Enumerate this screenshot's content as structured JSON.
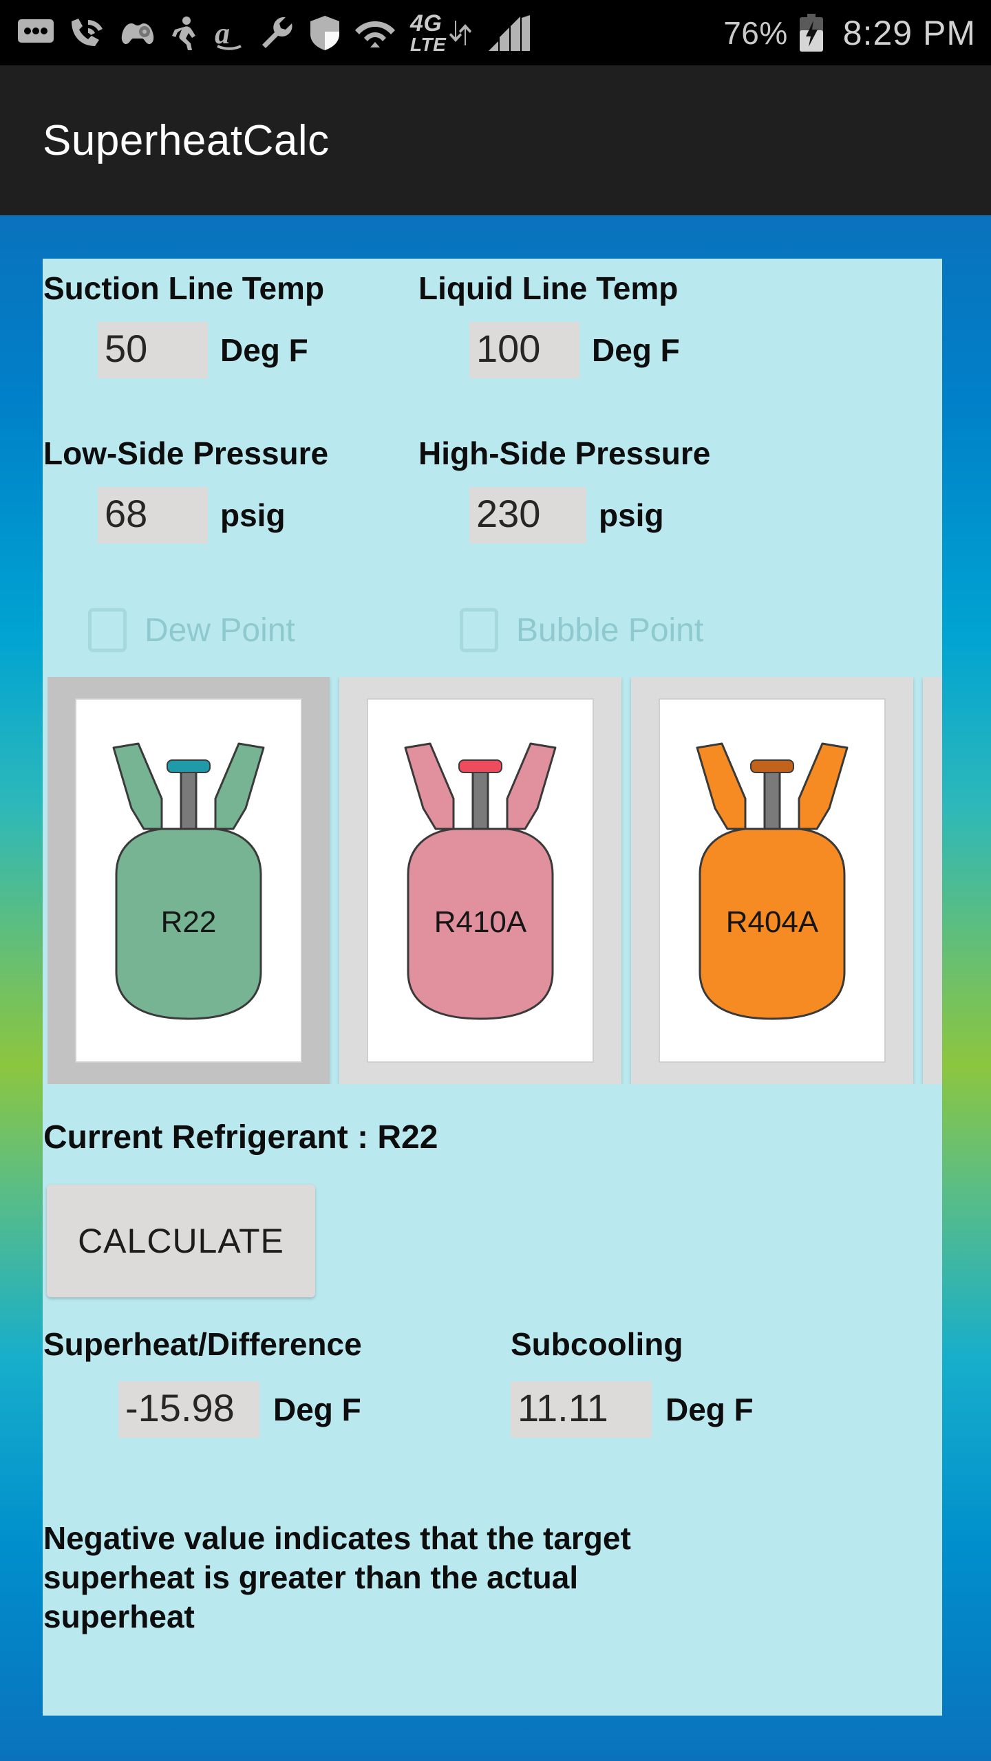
{
  "status_bar": {
    "icons": [
      "messages-icon",
      "wifi-calling-icon",
      "game-controller-icon",
      "running-person-icon",
      "amazon-icon",
      "wrench-icon",
      "shield-icon",
      "wifi-icon",
      "4g-lte-icon",
      "signal-bars-icon"
    ],
    "network_label_top": "4G",
    "network_label_bottom": "LTE",
    "battery_percent": "76%",
    "battery_state": "charging",
    "clock": "8:29 PM"
  },
  "app_bar": {
    "title": "SuperheatCalc"
  },
  "form": {
    "suction": {
      "label": "Suction Line Temp",
      "value": "50",
      "unit": "Deg F"
    },
    "liquid": {
      "label": "Liquid Line Temp",
      "value": "100",
      "unit": "Deg F"
    },
    "low_side": {
      "label": "Low-Side Pressure",
      "value": "68",
      "unit": "psig"
    },
    "high_side": {
      "label": "High-Side Pressure",
      "value": "230",
      "unit": "psig"
    }
  },
  "checkboxes": [
    {
      "label": "Dew Point",
      "checked": false
    },
    {
      "label": "Bubble Point",
      "checked": false
    }
  ],
  "refrigerants": [
    {
      "name": "R22",
      "body_color": "#76b493",
      "cap_color": "#1f9aa8",
      "selected": true
    },
    {
      "name": "R410A",
      "body_color": "#e1919e",
      "cap_color": "#ee4b5c",
      "selected": false
    },
    {
      "name": "R404A",
      "body_color": "#f58b22",
      "cap_color": "#c3621a",
      "selected": false
    },
    {
      "name": "",
      "body_color": "#bdbdbd",
      "cap_color": "#9e9e9e",
      "selected": false
    }
  ],
  "current_refrigerant": {
    "text": "Current Refrigerant : R22"
  },
  "calculate_button": {
    "label": "CALCULATE"
  },
  "results": {
    "superheat": {
      "label": "Superheat/Difference",
      "value": "-15.98",
      "unit": "Deg F"
    },
    "subcooling": {
      "label": "Subcooling",
      "value": "11.11",
      "unit": "Deg F"
    }
  },
  "note": {
    "text": "Negative value indicates that the target superheat is greater than the actual superheat"
  },
  "colors": {
    "panel_bg": "#b9e9ef",
    "input_bg": "#dddada",
    "app_bar_bg": "#1f1f1f",
    "status_bar_bg": "#000000",
    "gradient_top": "#0a72bd",
    "gradient_mid": "#8cc63f",
    "gradient_bottom": "#0a72bd"
  }
}
